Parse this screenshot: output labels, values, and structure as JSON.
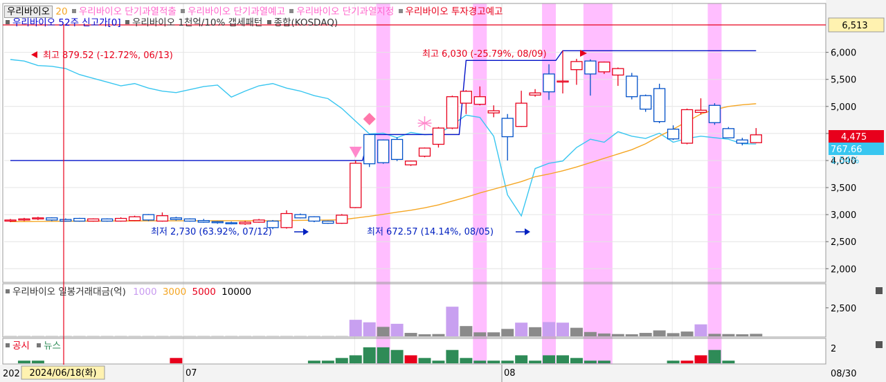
{
  "legend_main": {
    "stock_button": "우리바이오",
    "period": "20",
    "items": [
      {
        "label": "우리바이오 단기과열적출",
        "color": "#ff66cc"
      },
      {
        "label": "우리바이오 단기과열예고",
        "color": "#ff66cc"
      },
      {
        "label": "우리바이오 단기과열지정",
        "color": "#ff66cc"
      },
      {
        "label": "우리바이오 투자경고예고",
        "color": "#e8001c"
      }
    ],
    "row2": [
      {
        "label": "우리바이오 52주 신고가[0]",
        "color": "#0000cc"
      },
      {
        "label": "우리바이오 1천억/10% 갭세패턴",
        "color": "#333333"
      },
      {
        "label": "종합(KOSDAQ)",
        "color": "#333333"
      }
    ]
  },
  "annotations": {
    "high_kosdaq": "최고 879.52 (-12.72%, 06/13)",
    "high_price": "최고 6,030 (-25.79%, 08/09)",
    "low_price": "최저 2,730 (63.92%, 07/12)",
    "low_kosdaq": "최저 672.57 (14.14%, 08/05)"
  },
  "price_labels": {
    "top_box": "6,513",
    "last_price": "4,475",
    "kosdaq_value": "767.66",
    "kosdaq_change": "1.54%"
  },
  "volume_legend": {
    "title": "우리바이오 일봉거래대금(억)",
    "levels": [
      "1000",
      "3000",
      "5000",
      "10000"
    ]
  },
  "news_legend": {
    "notice": "공시",
    "news": "뉴스"
  },
  "x_axis": {
    "left_clip": "202",
    "crosshair_date": "2024/06/18(화)",
    "month_jul": "07",
    "month_aug": "08",
    "end_date": "08/30"
  },
  "colors": {
    "up": "#e8001c",
    "down": "#0050c8",
    "ma20": "#f5a623",
    "kosdaq": "#38c6f0",
    "highlight": "#ffb3ff",
    "vol_hi": "#c8a0f0",
    "vol_lo": "#8a8a8a",
    "news_green": "#2e8b57"
  },
  "chart_data": {
    "type": "candlestick",
    "x_range": [
      "2024-06-11",
      "2024-08-30"
    ],
    "y_axis": {
      "ticks": [
        2000,
        2500,
        3000,
        3500,
        4000,
        4500,
        5000,
        5500,
        6000
      ],
      "tick_labels": [
        "2,000",
        "2,500",
        "3,000",
        "3,500",
        "4,000",
        "4,500",
        "5,000",
        "5,500",
        "6,000"
      ],
      "ylim": [
        1850,
        6550
      ]
    },
    "volume_axis": {
      "tick": 2500,
      "tick_label": "2,500",
      "ylim": [
        0,
        3400
      ]
    },
    "news_axis": {
      "tick": 2,
      "tick_label": "2"
    },
    "candles": [
      {
        "o": 2880,
        "c": 2900,
        "h": 2920,
        "l": 2860
      },
      {
        "o": 2900,
        "c": 2920,
        "h": 2940,
        "l": 2880
      },
      {
        "o": 2920,
        "c": 2940,
        "h": 2960,
        "l": 2900
      },
      {
        "o": 2940,
        "c": 2900,
        "h": 2950,
        "l": 2880
      },
      {
        "o": 2910,
        "c": 2880,
        "h": 2930,
        "l": 2870
      },
      {
        "o": 2930,
        "c": 2880,
        "h": 2940,
        "l": 2870
      },
      {
        "o": 2880,
        "c": 2920,
        "h": 2930,
        "l": 2870
      },
      {
        "o": 2920,
        "c": 2880,
        "h": 2930,
        "l": 2870
      },
      {
        "o": 2880,
        "c": 2930,
        "h": 2950,
        "l": 2870
      },
      {
        "o": 2890,
        "c": 2960,
        "h": 2980,
        "l": 2880
      },
      {
        "o": 3000,
        "c": 2900,
        "h": 3010,
        "l": 2880
      },
      {
        "o": 2880,
        "c": 2980,
        "h": 3040,
        "l": 2870
      },
      {
        "o": 2940,
        "c": 2910,
        "h": 2960,
        "l": 2890
      },
      {
        "o": 2920,
        "c": 2880,
        "h": 2930,
        "l": 2870
      },
      {
        "o": 2890,
        "c": 2860,
        "h": 2920,
        "l": 2850
      },
      {
        "o": 2870,
        "c": 2850,
        "h": 2880,
        "l": 2830
      },
      {
        "o": 2850,
        "c": 2830,
        "h": 2870,
        "l": 2820
      },
      {
        "o": 2830,
        "c": 2860,
        "h": 2880,
        "l": 2810
      },
      {
        "o": 2860,
        "c": 2900,
        "h": 2920,
        "l": 2850
      },
      {
        "o": 2880,
        "c": 2760,
        "h": 2900,
        "l": 2730
      },
      {
        "o": 2760,
        "c": 3020,
        "h": 3080,
        "l": 2740
      },
      {
        "o": 3000,
        "c": 2940,
        "h": 3020,
        "l": 2930
      },
      {
        "o": 2960,
        "c": 2880,
        "h": 2970,
        "l": 2860
      },
      {
        "o": 2880,
        "c": 2840,
        "h": 2890,
        "l": 2830
      },
      {
        "o": 2840,
        "c": 2990,
        "h": 3010,
        "l": 2830
      },
      {
        "o": 3130,
        "c": 3950,
        "h": 4000,
        "l": 3120
      },
      {
        "o": 4480,
        "c": 3940,
        "h": 4480,
        "l": 3880
      },
      {
        "o": 4380,
        "c": 3960,
        "h": 4390,
        "l": 3940
      },
      {
        "o": 4390,
        "c": 4020,
        "h": 4430,
        "l": 3990
      },
      {
        "o": 3920,
        "c": 3990,
        "h": 4000,
        "l": 3900
      },
      {
        "o": 4080,
        "c": 4230,
        "h": 4240,
        "l": 4060
      },
      {
        "o": 4300,
        "c": 4600,
        "h": 4620,
        "l": 4240
      },
      {
        "o": 4600,
        "c": 5180,
        "h": 5200,
        "l": 4580
      },
      {
        "o": 5060,
        "c": 5280,
        "h": 5300,
        "l": 4860
      },
      {
        "o": 5040,
        "c": 5180,
        "h": 5370,
        "l": 5020
      },
      {
        "o": 4880,
        "c": 4920,
        "h": 5020,
        "l": 4800
      },
      {
        "o": 4780,
        "c": 4440,
        "h": 4860,
        "l": 4000
      },
      {
        "o": 4630,
        "c": 5060,
        "h": 5290,
        "l": 4620
      },
      {
        "o": 5210,
        "c": 5250,
        "h": 5320,
        "l": 5180
      },
      {
        "o": 5600,
        "c": 5270,
        "h": 5780,
        "l": 5120
      },
      {
        "o": 5460,
        "c": 5470,
        "h": 6030,
        "l": 5240
      },
      {
        "o": 5680,
        "c": 5830,
        "h": 5880,
        "l": 5400
      },
      {
        "o": 5840,
        "c": 5600,
        "h": 5870,
        "l": 5200
      },
      {
        "o": 5640,
        "c": 5820,
        "h": 5830,
        "l": 5600
      },
      {
        "o": 5580,
        "c": 5700,
        "h": 5720,
        "l": 5380
      },
      {
        "o": 5560,
        "c": 5180,
        "h": 5620,
        "l": 5130
      },
      {
        "o": 5200,
        "c": 4950,
        "h": 5220,
        "l": 4900
      },
      {
        "o": 5330,
        "c": 4720,
        "h": 5420,
        "l": 4690
      },
      {
        "o": 4580,
        "c": 4400,
        "h": 4650,
        "l": 4380
      },
      {
        "o": 4320,
        "c": 4940,
        "h": 4960,
        "l": 4300
      },
      {
        "o": 4890,
        "c": 4930,
        "h": 5150,
        "l": 4850
      },
      {
        "o": 5020,
        "c": 4700,
        "h": 5060,
        "l": 4660
      },
      {
        "o": 4590,
        "c": 4420,
        "h": 4620,
        "l": 4420
      },
      {
        "o": 4380,
        "c": 4320,
        "h": 4420,
        "l": 4280
      },
      {
        "o": 4330,
        "c": 4475,
        "h": 4600,
        "l": 4320
      }
    ],
    "ma20": [
      2870,
      2872,
      2874,
      2876,
      2878,
      2880,
      2880,
      2881,
      2882,
      2883,
      2884,
      2885,
      2886,
      2886,
      2887,
      2887,
      2887,
      2887,
      2888,
      2884,
      2890,
      2894,
      2897,
      2900,
      2905,
      2937,
      2968,
      3005,
      3045,
      3080,
      3125,
      3180,
      3250,
      3320,
      3400,
      3470,
      3540,
      3610,
      3700,
      3750,
      3810,
      3880,
      3960,
      4040,
      4120,
      4200,
      4310,
      4450,
      4580,
      4720,
      4860,
      4940,
      5000,
      5030,
      5050
    ],
    "kosdaq": [
      880,
      878,
      872,
      871,
      868,
      860,
      855,
      850,
      845,
      848,
      842,
      838,
      836,
      840,
      844,
      846,
      830,
      838,
      845,
      848,
      842,
      838,
      832,
      828,
      815,
      798,
      781,
      782,
      776,
      783,
      780,
      781,
      793,
      806,
      803,
      778,
      700,
      672,
      735,
      742,
      745,
      763,
      774,
      770,
      784,
      778,
      775,
      782,
      770,
      775,
      778,
      776,
      774,
      768,
      767.66
    ],
    "kosdaq_range": [
      600,
      900
    ],
    "high_line_52w": [
      4000,
      4000,
      4000,
      4000,
      4000,
      4000,
      4000,
      4000,
      4000,
      4000,
      4000,
      4000,
      4000,
      4000,
      4000,
      4000,
      4000,
      4000,
      4000,
      4000,
      4000,
      4000,
      4000,
      4000,
      4000,
      4000,
      4480,
      4480,
      4480,
      4480,
      4480,
      4480,
      4480,
      5850,
      5850,
      5850,
      5850,
      5850,
      5850,
      5850,
      6030,
      6030,
      6030,
      6030,
      6030,
      6030,
      6030,
      6030,
      6030,
      6030,
      6030,
      6030,
      6030,
      6030,
      6030
    ],
    "highlight_days": [
      27,
      34,
      39,
      42,
      43,
      51
    ],
    "volume": [
      20,
      20,
      20,
      20,
      20,
      20,
      20,
      20,
      20,
      20,
      20,
      20,
      20,
      20,
      20,
      20,
      20,
      20,
      20,
      20,
      20,
      20,
      20,
      20,
      20,
      1450,
      1230,
      830,
      1100,
      300,
      180,
      200,
      2600,
      900,
      350,
      350,
      650,
      1200,
      800,
      1250,
      1200,
      750,
      380,
      250,
      200,
      180,
      300,
      520,
      280,
      420,
      1050,
      220,
      200,
      180,
      220
    ],
    "news": [
      0,
      1,
      1,
      0,
      0,
      0,
      0,
      0,
      0,
      0,
      0,
      0,
      2,
      0,
      0,
      0,
      0,
      0,
      0,
      0,
      0,
      0,
      1,
      1,
      2,
      3,
      6,
      6,
      5,
      3,
      2,
      1,
      5,
      2,
      1,
      1,
      1,
      3,
      1,
      3,
      3,
      2,
      1,
      1,
      0,
      0,
      0,
      0,
      1,
      1,
      3,
      5,
      1,
      0,
      0
    ],
    "news_red_days": [
      12,
      29,
      49,
      50
    ]
  }
}
